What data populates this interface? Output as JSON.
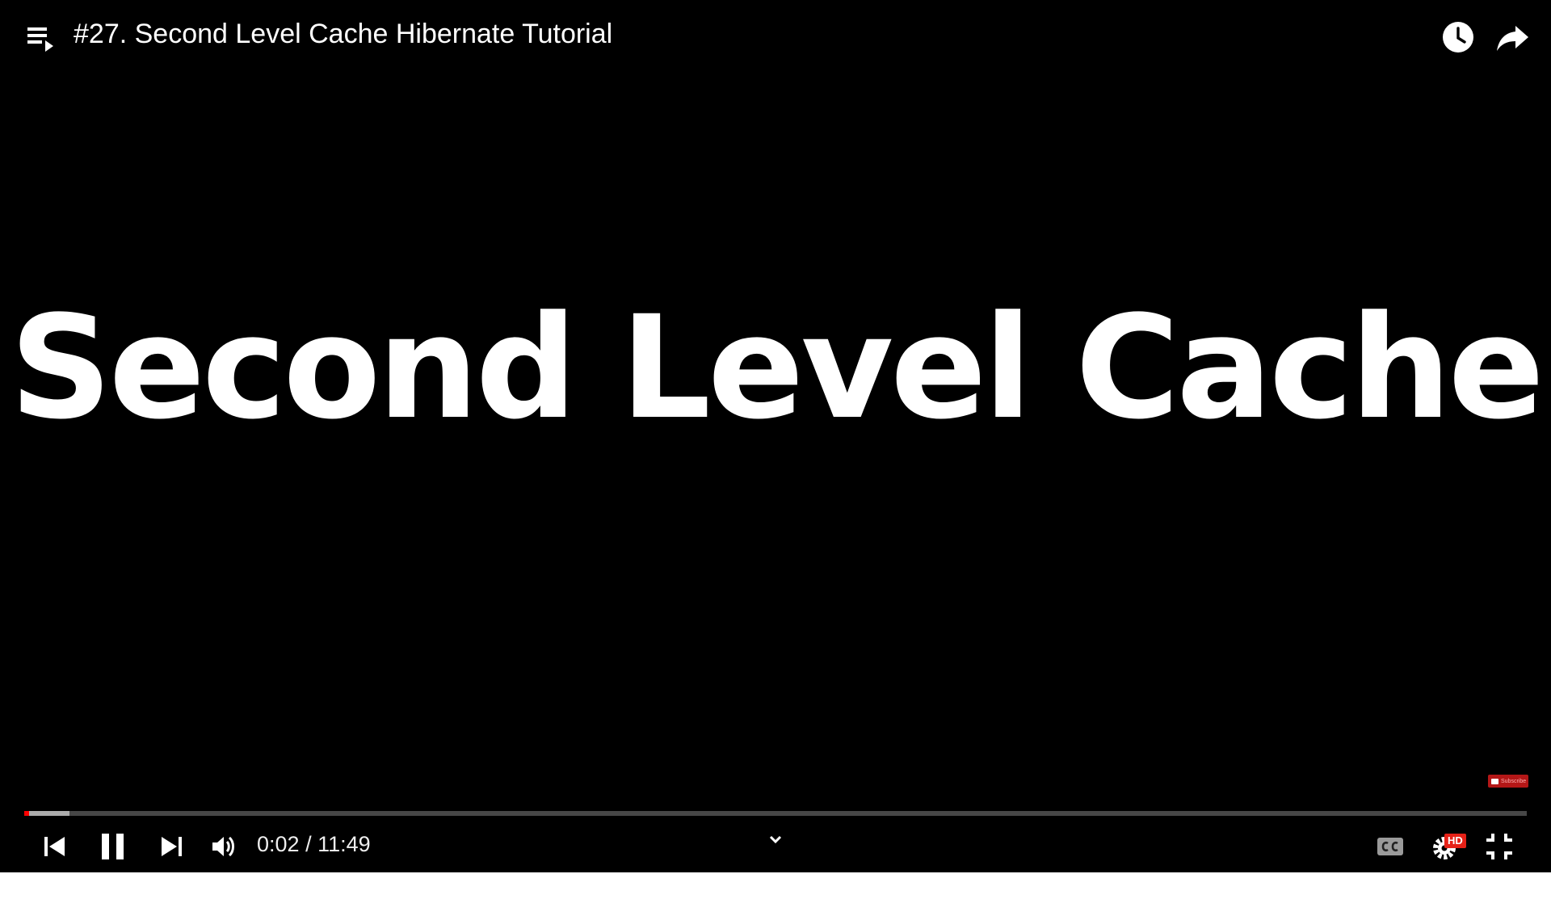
{
  "player": {
    "title": "#27. Second Level Cache Hibernate Tutorial",
    "slide_text": "Second Level Cache",
    "watermark": {
      "label": "Subscribe"
    },
    "progress": {
      "current_seconds": 2,
      "duration_seconds": 709,
      "played_fraction": 0.003,
      "buffered_fraction": 0.03
    },
    "time": {
      "current": "0:02",
      "separator": " / ",
      "duration": "11:49"
    },
    "badges": {
      "hd": "HD"
    },
    "icons": {
      "playlist": "playlist-icon",
      "watch_later": "clock-icon",
      "share": "share-icon",
      "previous": "skip-previous-icon",
      "pause": "pause-icon",
      "next": "skip-next-icon",
      "volume": "volume-icon",
      "expand": "chevron-down-icon",
      "captions": "cc-icon",
      "settings": "gear-icon",
      "exit_fullscreen": "exit-fullscreen-icon"
    },
    "colors": {
      "accent": "#ff0000",
      "background": "#000000",
      "hd_badge": "#e62117",
      "text": "#ffffff"
    }
  }
}
